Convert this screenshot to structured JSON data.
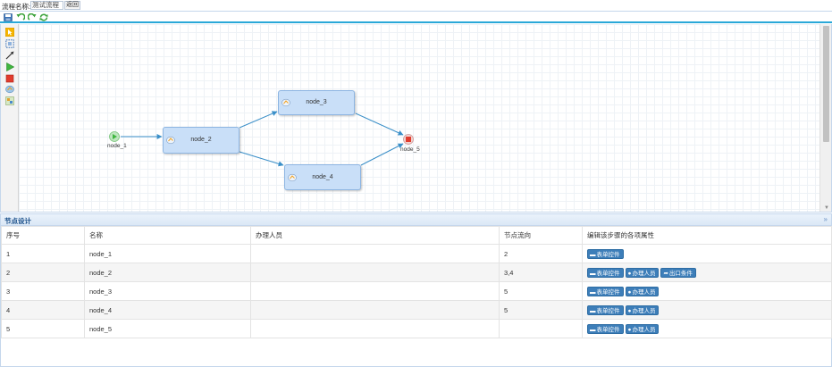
{
  "header": {
    "flow_name_label": "流程名称:",
    "flow_name_value": "测试流程",
    "back_label": "返回"
  },
  "toolbar": {
    "icons": [
      "save-icon",
      "undo-icon",
      "redo-icon",
      "refresh-icon"
    ]
  },
  "palette": {
    "tools": [
      "select-tool-icon",
      "marquee-tool-icon",
      "line-tool-icon",
      "start-node-icon",
      "end-node-icon",
      "task-node-icon",
      "subflow-node-icon"
    ]
  },
  "diagram": {
    "nodes": [
      {
        "id": "node_1",
        "label": "node_1",
        "kind": "start"
      },
      {
        "id": "node_2",
        "label": "node_2",
        "kind": "task"
      },
      {
        "id": "node_3",
        "label": "node_3",
        "kind": "task"
      },
      {
        "id": "node_4",
        "label": "node_4",
        "kind": "task"
      },
      {
        "id": "node_5",
        "label": "node_5",
        "kind": "end"
      }
    ],
    "edges": [
      [
        "node_1",
        "node_2"
      ],
      [
        "node_2",
        "node_3"
      ],
      [
        "node_2",
        "node_4"
      ],
      [
        "node_3",
        "node_5"
      ],
      [
        "node_4",
        "node_5"
      ]
    ],
    "node_fill": "#c9dff8",
    "edge_color": "#3a8fc8"
  },
  "node_panel": {
    "title": "节点设计",
    "columns": [
      "序号",
      "名称",
      "办理人员",
      "节点流向",
      "编辑该步骤的各项属性"
    ],
    "buttons": {
      "form": "表单控件",
      "handler": "办理人员",
      "exit": "出口条件"
    },
    "rows": [
      {
        "index": "1",
        "name": "node_1",
        "handler": "",
        "flow": "2",
        "actions": [
          "form"
        ]
      },
      {
        "index": "2",
        "name": "node_2",
        "handler": "",
        "flow": "3,4",
        "actions": [
          "form",
          "handler",
          "exit"
        ]
      },
      {
        "index": "3",
        "name": "node_3",
        "handler": "",
        "flow": "5",
        "actions": [
          "form",
          "handler"
        ]
      },
      {
        "index": "4",
        "name": "node_4",
        "handler": "",
        "flow": "5",
        "actions": [
          "form",
          "handler"
        ]
      },
      {
        "index": "5",
        "name": "node_5",
        "handler": "",
        "flow": "",
        "actions": [
          "form",
          "handler"
        ]
      }
    ]
  }
}
